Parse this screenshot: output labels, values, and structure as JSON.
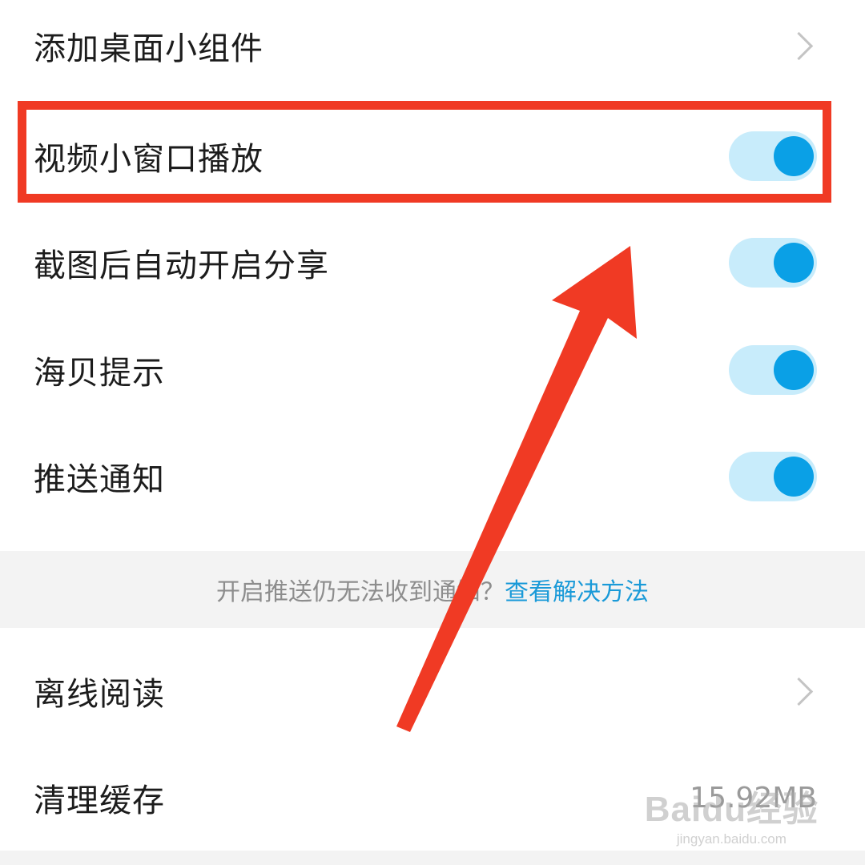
{
  "settings": {
    "rows": [
      {
        "label": "添加桌面小组件",
        "control": "chevron"
      },
      {
        "label": "视频小窗口播放",
        "control": "toggle",
        "on": true
      },
      {
        "label": "截图后自动开启分享",
        "control": "toggle",
        "on": true
      },
      {
        "label": "海贝提示",
        "control": "toggle",
        "on": true
      },
      {
        "label": "推送通知",
        "control": "toggle",
        "on": true
      }
    ],
    "push_tip": {
      "text": "开启推送仍无法收到通知？",
      "link": "查看解决方法"
    },
    "offline_reading": {
      "label": "离线阅读",
      "control": "chevron"
    },
    "clear_cache": {
      "label": "清理缓存",
      "value": "15.92MB"
    }
  },
  "annotation": {
    "highlight_color": "#f03a24",
    "arrow_color": "#f03a24",
    "highlighted_row": "视频小窗口播放"
  },
  "watermark": {
    "main": "Baidu经验",
    "sub": "jingyan.baidu.com"
  },
  "colors": {
    "toggle_track": "#c8ecfb",
    "toggle_knob": "#0aa0e6",
    "link": "#1a9ad8",
    "tip_background": "#f3f3f3"
  }
}
